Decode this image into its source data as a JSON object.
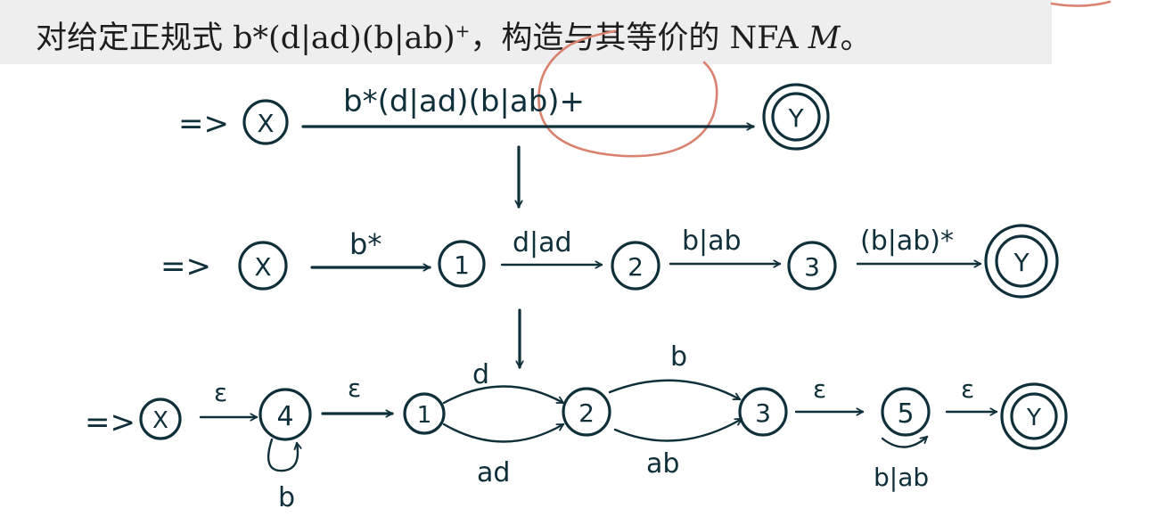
{
  "question": {
    "prefix": "对给定正规式 ",
    "regex": "b*(d|ad)(b|ab)",
    "sup": "+",
    "middle": "，构造与其等价的 NFA ",
    "machine": "M",
    "suffix": "。"
  },
  "row1": {
    "start_arrow": "=>",
    "start_state": "X",
    "edge_label": "b*(d|ad)(b|ab)+",
    "end_state": "Y"
  },
  "row2": {
    "start_arrow": "=>",
    "states": [
      "X",
      "1",
      "2",
      "3",
      "Y"
    ],
    "edge_labels": [
      "b*",
      "d|ad",
      "b|ab",
      "(b|ab)*"
    ]
  },
  "row3": {
    "start_arrow": "=>",
    "states": [
      "X",
      "4",
      "1",
      "2",
      "3",
      "5",
      "Y"
    ],
    "edge_labels": {
      "x_to_4": "ε",
      "4_loop": "b",
      "4_to_1": "ε",
      "1_to_2_top": "d",
      "1_to_2_bottom": "ad",
      "2_to_3_top": "b",
      "2_to_3_bottom": "ab",
      "3_to_5": "ε",
      "5_loop": "b|ab",
      "5_to_y": "ε"
    }
  },
  "colors": {
    "ink": "#0f2f3a",
    "annotation": "#d9826f",
    "question_bg": "#eeeeee"
  }
}
